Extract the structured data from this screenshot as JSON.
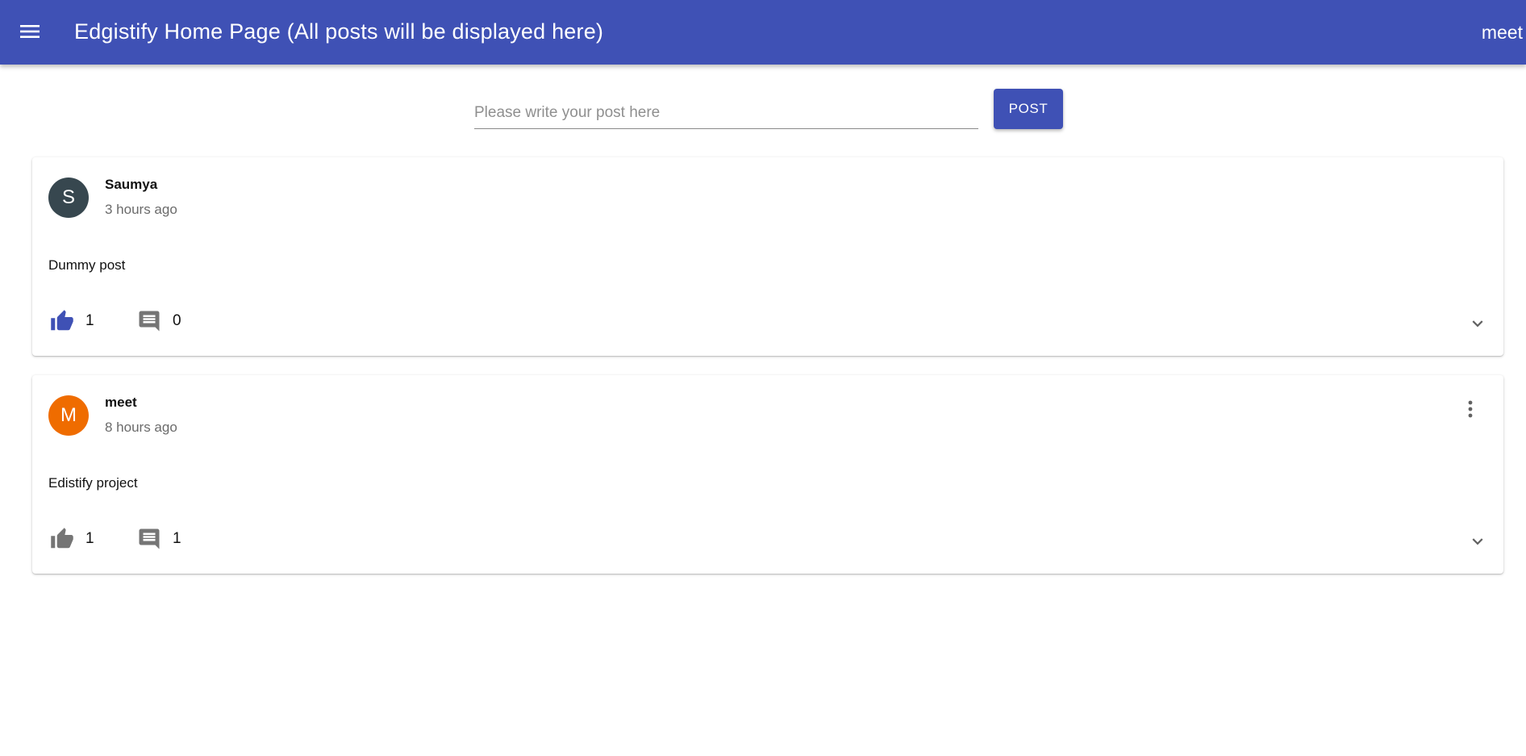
{
  "header": {
    "menu_icon": "menu-icon",
    "title": "Edgistify Home Page (All posts will be displayed here)",
    "user": "meet"
  },
  "composer": {
    "placeholder": "Please write your post here",
    "value": "",
    "button_label": "POST"
  },
  "colors": {
    "primary": "#3f51b5",
    "like_active": "#3f51b5",
    "icon_inactive": "#757575",
    "avatar_s": "#37474f",
    "avatar_m": "#ef6c00"
  },
  "posts": [
    {
      "avatar_letter": "S",
      "author": "Saumya",
      "time": "3 hours ago",
      "content": "Dummy post",
      "likes": "1",
      "comments": "0",
      "liked": true,
      "has_menu": false
    },
    {
      "avatar_letter": "M",
      "author": "meet",
      "time": "8 hours ago",
      "content": "Edistify project",
      "likes": "1",
      "comments": "1",
      "liked": false,
      "has_menu": true
    }
  ],
  "icons": {
    "like": "thumb-up-icon",
    "comment": "comment-icon",
    "expand": "chevron-down-icon",
    "more": "more-vert-icon"
  }
}
